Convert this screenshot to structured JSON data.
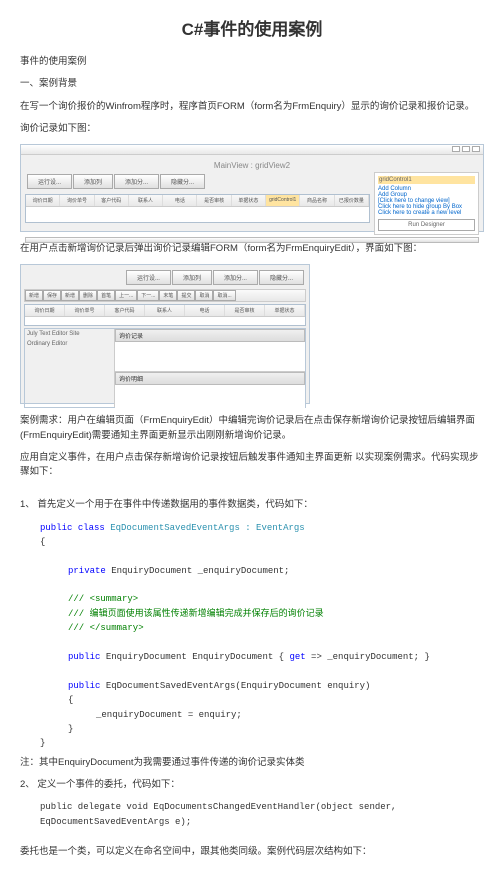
{
  "title": "C#事件的使用案例",
  "p1": "事件的使用案例",
  "p2": "一、案例背景",
  "p3": "在写一个询价报价的Winfrom程序时，程序首页FORM（form名为FrmEnquiry）显示的询价记录和报价记录。",
  "p4": "询价记录如下图：",
  "screenshot1": {
    "title_text": "MainView : gridView2",
    "toolbar": [
      "运行设...",
      "添加列",
      "添加分...",
      "隐藏分..."
    ],
    "grid_cols": [
      "询价日期",
      "询价单号",
      "客户代码",
      "联系人",
      "电话",
      "是否审核",
      "单据状态",
      "gridControl1",
      "商品名称",
      "已报价数量"
    ],
    "right_links": [
      "Add Column",
      "Add Group",
      "[Click here to change view]",
      "Click here to hide group By Box",
      "Click here to create a new level",
      "Run Designer"
    ]
  },
  "p5": "在用户点击新增询价记录后弹出询价记录编辑FORM（form名为FrmEnquiryEdit），界面如下图：",
  "screenshot2": {
    "tabs": [
      "运行设...",
      "添加列",
      "添加分...",
      "隐藏分..."
    ],
    "btn_row": [
      "新增",
      "保存",
      "新增",
      "删除",
      "首笔",
      "上一...",
      "下一...",
      "末笔",
      "提交",
      "取消",
      "取消..."
    ],
    "grid_cols2": [
      "询价日期",
      "询价单号",
      "客户代码",
      "联系人",
      "电话",
      "是否审核",
      "单据状态"
    ],
    "section_labels": [
      "询价记录",
      "询价明细"
    ],
    "left_entries": [
      "July Text Editor Site",
      "Ordinary Editor"
    ]
  },
  "p6": "案例需求：用户在编辑页面（FrmEnquiryEdit）中编辑完询价记录后在点击保存新增询价记录按钮后编辑界面(FrmEnquiryEdit)需要通知主界面更新显示出刚刚新增询价记录。",
  "p7": "应用自定义事件，在用户点击保存新增询价记录按钮后触发事件通知主界面更新 以实现案例需求。代码实现步骤如下：",
  "p8": "1、 首先定义一个用于在事件中传递数据用的事件数据类，代码如下：",
  "code1": {
    "l1a": "public",
    "l1b": "class",
    "l1c": "EqDocumentSavedEventArgs : EventArgs",
    "l2": "{",
    "l3a": "private",
    "l3b": "EnquiryDocument _enquiryDocument;",
    "l4": "/// <summary>",
    "l5": "/// 编辑页面使用该属性传递新增编辑完成并保存后的询价记录",
    "l6": "/// </summary>",
    "l7a": "public",
    "l7b": "EnquiryDocument EnquiryDocument {",
    "l7c": "get",
    "l7d": " => _enquiryDocument; }",
    "l8a": "public",
    "l8b": "EqDocumentSavedEventArgs(EnquiryDocument enquiry)",
    "l9": "{",
    "l10": "_enquiryDocument = enquiry;",
    "l11": "}",
    "l12": "}"
  },
  "p9": "注：其中EnquiryDocument为我需要通过事件传递的询价记录实体类",
  "p10": "2、 定义一个事件的委托，代码如下：",
  "code2": "public delegate void EqDocumentsChangedEventHandler(object sender, EqDocumentSavedEventArgs e);",
  "p11": "委托也是一个类，可以定义在命名空间中，跟其他类同级。案例代码层次结构如下："
}
